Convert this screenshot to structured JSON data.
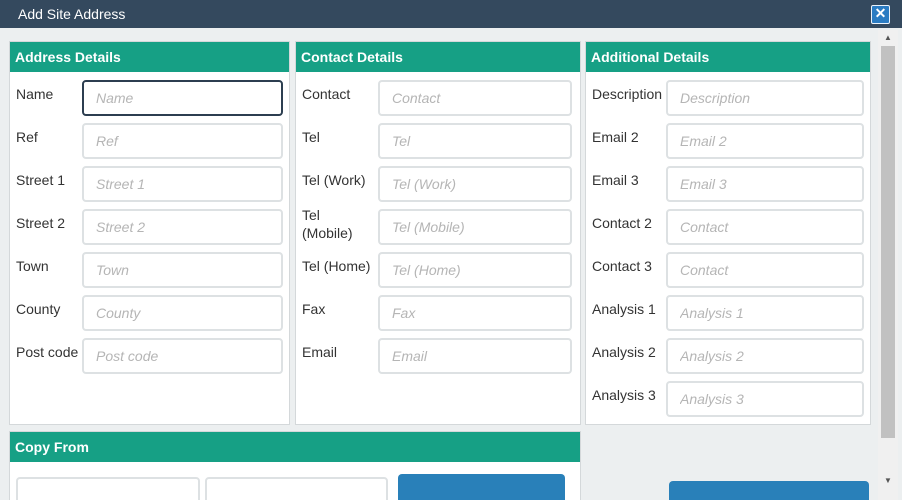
{
  "dialog": {
    "title": "Add Site Address",
    "close_icon": "close-icon",
    "close_glyph": "✕"
  },
  "address_details": {
    "header": "Address Details",
    "fields": [
      {
        "label": "Name",
        "placeholder": "Name"
      },
      {
        "label": "Ref",
        "placeholder": "Ref"
      },
      {
        "label": "Street 1",
        "placeholder": "Street 1"
      },
      {
        "label": "Street 2",
        "placeholder": "Street 2"
      },
      {
        "label": "Town",
        "placeholder": "Town"
      },
      {
        "label": "County",
        "placeholder": "County"
      },
      {
        "label": "Post code",
        "placeholder": "Post code"
      }
    ]
  },
  "contact_details": {
    "header": "Contact Details",
    "fields": [
      {
        "label": "Contact",
        "placeholder": "Contact"
      },
      {
        "label": "Tel",
        "placeholder": "Tel"
      },
      {
        "label": "Tel (Work)",
        "placeholder": "Tel (Work)"
      },
      {
        "label": "Tel (Mobile)",
        "placeholder": "Tel (Mobile)"
      },
      {
        "label": "Tel (Home)",
        "placeholder": "Tel (Home)"
      },
      {
        "label": "Fax",
        "placeholder": "Fax"
      },
      {
        "label": "Email",
        "placeholder": "Email"
      }
    ]
  },
  "additional_details": {
    "header": "Additional Details",
    "fields": [
      {
        "label": "Description",
        "placeholder": "Description"
      },
      {
        "label": "Email 2",
        "placeholder": "Email 2"
      },
      {
        "label": "Email 3",
        "placeholder": "Email 3"
      },
      {
        "label": "Contact 2",
        "placeholder": "Contact"
      },
      {
        "label": "Contact 3",
        "placeholder": "Contact"
      },
      {
        "label": "Analysis 1",
        "placeholder": "Analysis 1"
      },
      {
        "label": "Analysis 2",
        "placeholder": "Analysis 2"
      },
      {
        "label": "Analysis 3",
        "placeholder": "Analysis 3"
      }
    ]
  },
  "copy_from": {
    "header": "Copy From"
  },
  "scrollbar": {
    "up_glyph": "▲",
    "down_glyph": "▼"
  },
  "colors": {
    "title_bar": "#34495e",
    "panel_header": "#16a085",
    "button": "#2980b9"
  }
}
